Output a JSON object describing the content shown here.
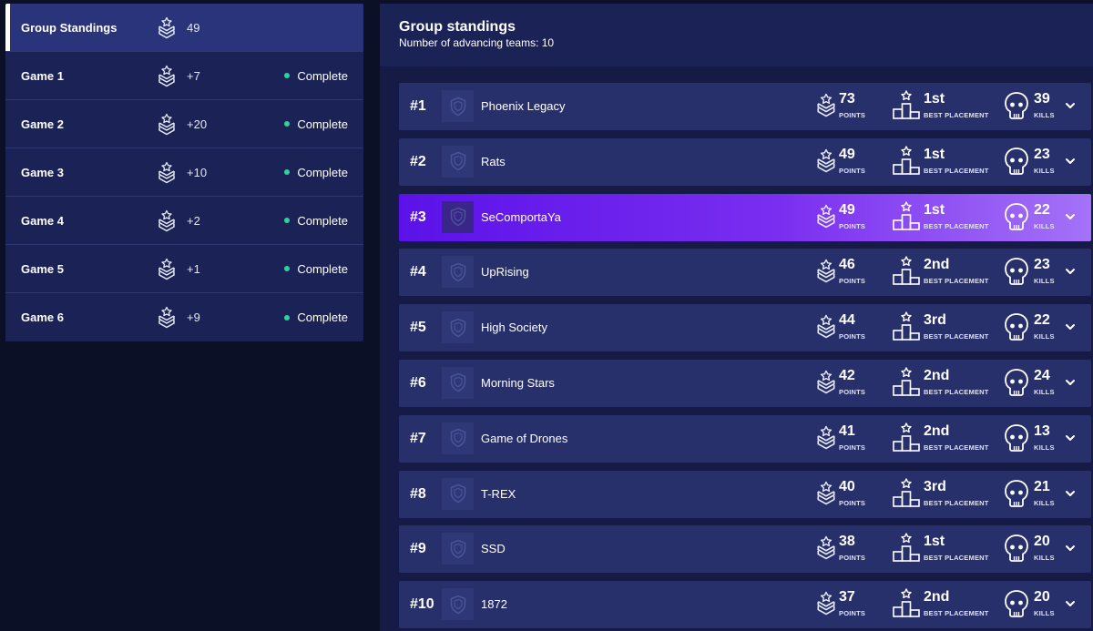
{
  "sidebar": {
    "items": [
      {
        "label": "Group Standings",
        "points": "49",
        "status": ""
      },
      {
        "label": "Game 1",
        "points": "+7",
        "status": "Complete"
      },
      {
        "label": "Game 2",
        "points": "+20",
        "status": "Complete"
      },
      {
        "label": "Game 3",
        "points": "+10",
        "status": "Complete"
      },
      {
        "label": "Game 4",
        "points": "+2",
        "status": "Complete"
      },
      {
        "label": "Game 5",
        "points": "+1",
        "status": "Complete"
      },
      {
        "label": "Game 6",
        "points": "+9",
        "status": "Complete"
      }
    ],
    "icon": "rank-chevron-icon",
    "status_color": "#2bd49a"
  },
  "main": {
    "title": "Group standings",
    "subtitle": "Number of advancing teams: 10",
    "points_caption": "POINTS",
    "placement_caption": "BEST PLACEMENT",
    "kills_caption": "KILLS",
    "highlight_color": "#5b12e8",
    "standings": [
      {
        "rank": "#1",
        "team": "Phoenix Legacy",
        "points": "73",
        "placement": "1st",
        "kills": "39"
      },
      {
        "rank": "#2",
        "team": "Rats",
        "points": "49",
        "placement": "1st",
        "kills": "23"
      },
      {
        "rank": "#3",
        "team": "SeComportaYa",
        "points": "49",
        "placement": "1st",
        "kills": "22"
      },
      {
        "rank": "#4",
        "team": "UpRising",
        "points": "46",
        "placement": "2nd",
        "kills": "23"
      },
      {
        "rank": "#5",
        "team": "High Society",
        "points": "44",
        "placement": "3rd",
        "kills": "22"
      },
      {
        "rank": "#6",
        "team": "Morning Stars",
        "points": "42",
        "placement": "2nd",
        "kills": "24"
      },
      {
        "rank": "#7",
        "team": "Game of Drones",
        "points": "41",
        "placement": "2nd",
        "kills": "13"
      },
      {
        "rank": "#8",
        "team": "T-REX",
        "points": "40",
        "placement": "3rd",
        "kills": "21"
      },
      {
        "rank": "#9",
        "team": "SSD",
        "points": "38",
        "placement": "1st",
        "kills": "20"
      },
      {
        "rank": "#10",
        "team": "1872",
        "points": "37",
        "placement": "2nd",
        "kills": "20"
      }
    ]
  }
}
